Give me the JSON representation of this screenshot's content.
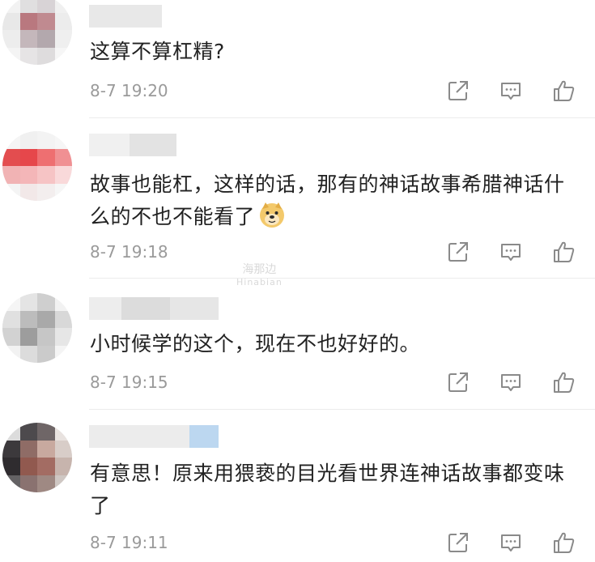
{
  "comments": [
    {
      "text": "这算不算杠精?",
      "time": "8-7 19:20",
      "avatar_colors": [
        "#f2f2f2",
        "#e0dfe0",
        "#d8d3d6",
        "#f0f0f0",
        "#e8e8e8",
        "#b9787f",
        "#c08a90",
        "#ececec",
        "#ededed",
        "#c4b7bb",
        "#b3a8ad",
        "#efefef",
        "#f4f4f4",
        "#e6e4e5",
        "#dedcdd",
        "#f6f6f6"
      ]
    },
    {
      "text": "故事也能杠，这样的话，那有的神话故事希腊神话什么的不也不能看了",
      "time": "8-7 19:18",
      "avatar_colors": [
        "#f5f5f5",
        "#f0f0f0",
        "#f3f3f3",
        "#f6f6f6",
        "#e34d4f",
        "#e6474b",
        "#ee6f71",
        "#f09093",
        "#f1b3b4",
        "#f4b6b8",
        "#f6c4c5",
        "#f9d9da",
        "#f4f4f4",
        "#f2e8e8",
        "#f3eeee",
        "#f6f6f6"
      ]
    },
    {
      "text": "小时候学的这个，现在不也好好的。",
      "time": "8-7 19:15",
      "avatar_colors": [
        "#f5f5f5",
        "#e4e4e4",
        "#cfcfcf",
        "#f2f2f2",
        "#e0e0e0",
        "#bcbcbc",
        "#a9a9a9",
        "#d8d8d8",
        "#d2d2d2",
        "#9d9d9d",
        "#c6c6c6",
        "#e6e6e6",
        "#f2f2f2",
        "#dcdcdc",
        "#cbcbcb",
        "#f4f4f4"
      ]
    },
    {
      "text": "有意思！原来用猥亵的目光看世界连神话故事都变味了",
      "time": "8-7 19:11",
      "avatar_colors": [
        "#dcdcdc",
        "#4d4a4d",
        "#6f6667",
        "#e8e2df",
        "#3c393c",
        "#8f6c66",
        "#c8a99f",
        "#d8cdc8",
        "#2f2c2f",
        "#91594f",
        "#a36c63",
        "#c7b4ad",
        "#646264",
        "#8a7270",
        "#9f8983",
        "#cfc7c3"
      ]
    }
  ],
  "watermark": {
    "brand": "海那边",
    "sub": "Hinabian"
  },
  "icons": {
    "share": "share-icon",
    "comment": "comment-icon",
    "like": "thumbs-up-icon",
    "emoji": "doge-emoji-icon"
  }
}
